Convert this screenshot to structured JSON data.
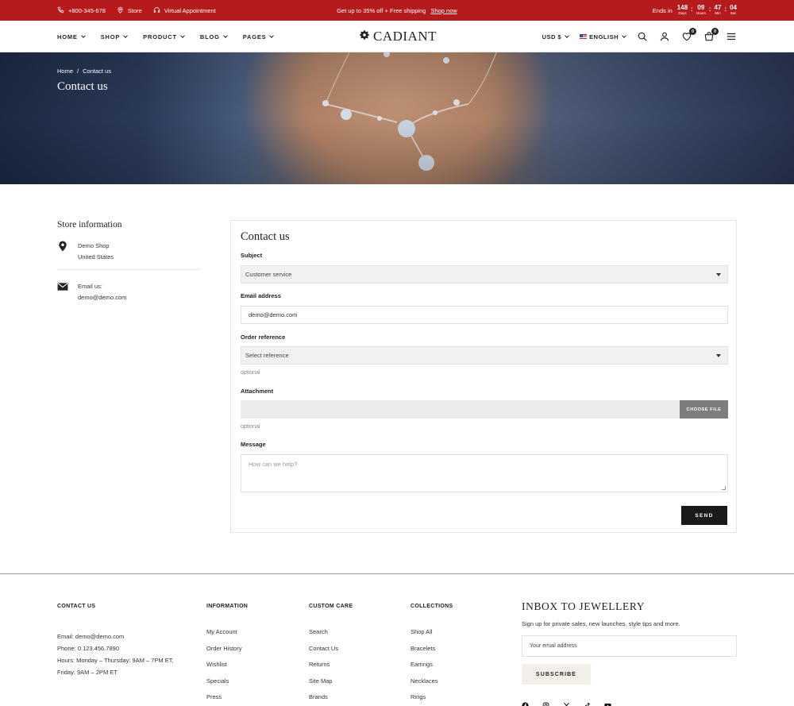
{
  "topbar": {
    "phone": "+800-345-678",
    "store": "Store",
    "virtual": "Virtual Appointment",
    "promo": "Get up to 35% off + Free shipping",
    "promo_link": "Shop now",
    "ends_label": "Ends in",
    "countdown": {
      "days": "148",
      "days_label": "Days",
      "hours": "09",
      "hours_label": "Hours",
      "min": "47",
      "min_label": "Min",
      "sec": "04",
      "sec_label": "Sec"
    },
    "bg_color": "#b51a1c"
  },
  "header": {
    "nav": [
      "HOME",
      "SHOP",
      "PRODUCT",
      "BLOG",
      "PAGES"
    ],
    "logo": "CADIANT",
    "currency": "USD $",
    "language": "ENGLISH",
    "wishlist_count": "0",
    "cart_count": "0"
  },
  "hero": {
    "breadcrumb_home": "Home",
    "breadcrumb_sep": "/",
    "breadcrumb_current": "Contact us",
    "title": "Contact us"
  },
  "store": {
    "title": "Store information",
    "address_line1": "Demo Shop",
    "address_line2": "United States",
    "email_label": "Email us:",
    "email": "demo@demo.com"
  },
  "form": {
    "title": "Contact us",
    "subject_label": "Subject",
    "subject_value": "Customer service",
    "email_label": "Email address",
    "email_value": "demo@demo.com",
    "order_label": "Order reference",
    "order_value": "Select reference",
    "optional_1": "optional",
    "attachment_label": "Attachment",
    "choose_file": "CHOOSE FILE",
    "optional_2": "optional",
    "message_label": "Message",
    "message_placeholder": "How can we help?",
    "send": "SEND"
  },
  "footer": {
    "contact": {
      "title": "CONTACT US",
      "email": "Email: demo@demo.com",
      "phone": "Phone: 0.123.456.7890",
      "hours": "Hours: Monday – Thursday: 9AM – 7PM ET, Friday: 9AM – 2PM ET"
    },
    "information": {
      "title": "INFORMATION",
      "links": [
        "My Account",
        "Order History",
        "Wishlist",
        "Specials",
        "Press"
      ]
    },
    "custom_care": {
      "title": "CUSTOM CARE",
      "links": [
        "Search",
        "Contact Us",
        "Returns",
        "Site Map",
        "Brands"
      ]
    },
    "collections": {
      "title": "COLLECTIONS",
      "links": [
        "Shop All",
        "Bracelets",
        "Earrings",
        "Necklaces",
        "Rings"
      ]
    },
    "newsletter": {
      "title": "INBOX TO JEWELLERY",
      "subtitle": "Sign up for private sales, new launches, style tips and more.",
      "placeholder": "Your email address",
      "button": "SUBSCRIBE"
    },
    "social_icons": [
      "facebook-icon",
      "instagram-icon",
      "x-icon",
      "tiktok-icon",
      "youtube-icon"
    ]
  }
}
